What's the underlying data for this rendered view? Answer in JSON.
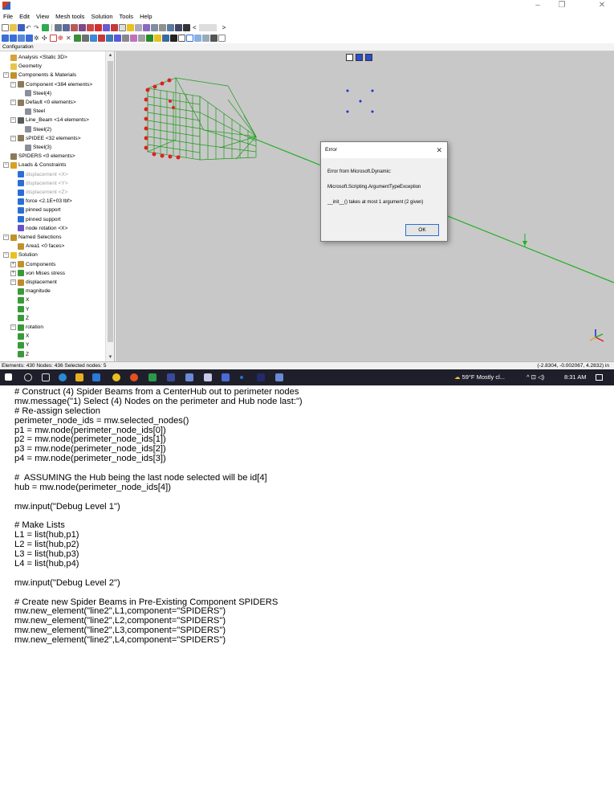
{
  "window": {
    "minimize": "–",
    "restore": "❐",
    "close": "✕"
  },
  "menu": [
    "File",
    "Edit",
    "View",
    "Mesh tools",
    "Solution",
    "Tools",
    "Help"
  ],
  "toolbar": {
    "nav_prev": "<",
    "nav_next": ">"
  },
  "config_label": "Configuration",
  "tree": [
    {
      "label": "Analysis <Static 3D>",
      "indent": 1,
      "icon": "analysis-icon",
      "color": "#d9a13a",
      "grey": false,
      "exp": ""
    },
    {
      "label": "Geometry",
      "indent": 1,
      "icon": "folder-icon",
      "color": "#e8c44a",
      "grey": false,
      "exp": ""
    },
    {
      "label": "Components & Materials",
      "indent": 0,
      "icon": "components-icon",
      "color": "#c0922a",
      "grey": false,
      "exp": "-"
    },
    {
      "label": "Component <384 elements>",
      "indent": 1,
      "icon": "component-icon",
      "color": "#8a7a5a",
      "grey": false,
      "exp": "-"
    },
    {
      "label": "Steel(4)",
      "indent": 3,
      "icon": "material-icon",
      "color": "#8a8f9a",
      "grey": false,
      "exp": ""
    },
    {
      "label": "Default <0 elements>",
      "indent": 1,
      "icon": "component-icon",
      "color": "#8a7a5a",
      "grey": false,
      "exp": "-"
    },
    {
      "label": "Steel",
      "indent": 3,
      "icon": "material-icon",
      "color": "#8a8f9a",
      "grey": false,
      "exp": ""
    },
    {
      "label": "Line_Beam <14 elements>",
      "indent": 1,
      "icon": "beam-icon",
      "color": "#5a5a5a",
      "grey": false,
      "exp": "-"
    },
    {
      "label": "Steel(2)",
      "indent": 3,
      "icon": "material-icon",
      "color": "#8a8f9a",
      "grey": false,
      "exp": ""
    },
    {
      "label": "sPIDEE <32 elements>",
      "indent": 1,
      "icon": "component-icon",
      "color": "#8a7a5a",
      "grey": false,
      "exp": "-"
    },
    {
      "label": "Steel(3)",
      "indent": 3,
      "icon": "material-icon",
      "color": "#8a8f9a",
      "grey": false,
      "exp": ""
    },
    {
      "label": "SPIDERS <0 elements>",
      "indent": 1,
      "icon": "component-icon",
      "color": "#8a7a5a",
      "grey": false,
      "exp": ""
    },
    {
      "label": "Loads & Constraints",
      "indent": 0,
      "icon": "loads-icon",
      "color": "#d8a020",
      "grey": false,
      "exp": "-"
    },
    {
      "label": "displacement <X>",
      "indent": 2,
      "icon": "constraint-icon",
      "color": "#2a6fd6",
      "grey": true,
      "exp": ""
    },
    {
      "label": "displacement <Y>",
      "indent": 2,
      "icon": "constraint-icon",
      "color": "#2a6fd6",
      "grey": true,
      "exp": ""
    },
    {
      "label": "displacement <Z>",
      "indent": 2,
      "icon": "constraint-icon",
      "color": "#2a6fd6",
      "grey": true,
      "exp": ""
    },
    {
      "label": "force <2.1E+03 lbf>",
      "indent": 2,
      "icon": "force-icon",
      "color": "#2a6fd6",
      "grey": false,
      "exp": ""
    },
    {
      "label": "pinned support",
      "indent": 2,
      "icon": "support-icon",
      "color": "#2a6fd6",
      "grey": false,
      "exp": ""
    },
    {
      "label": "pinned support",
      "indent": 2,
      "icon": "support-icon",
      "color": "#2a6fd6",
      "grey": false,
      "exp": ""
    },
    {
      "label": "node rotation <X>",
      "indent": 2,
      "icon": "rotation-icon",
      "color": "#6a4fcf",
      "grey": false,
      "exp": ""
    },
    {
      "label": "Named Selections",
      "indent": 0,
      "icon": "selections-icon",
      "color": "#c0922a",
      "grey": false,
      "exp": "-"
    },
    {
      "label": "Area1 <0 faces>",
      "indent": 2,
      "icon": "area-icon",
      "color": "#c0922a",
      "grey": false,
      "exp": ""
    },
    {
      "label": "Solution",
      "indent": 0,
      "icon": "solution-icon",
      "color": "#e8c020",
      "grey": false,
      "exp": "-"
    },
    {
      "label": "Components",
      "indent": 1,
      "icon": "components-icon",
      "color": "#c0922a",
      "grey": false,
      "exp": "+"
    },
    {
      "label": "von Mises stress",
      "indent": 1,
      "icon": "result-icon",
      "color": "#3a9a3a",
      "grey": false,
      "exp": "+"
    },
    {
      "label": "displacement",
      "indent": 1,
      "icon": "displacement-icon",
      "color": "#c08a2a",
      "grey": false,
      "exp": "-"
    },
    {
      "label": "magnitude",
      "indent": 2,
      "icon": "result-icon",
      "color": "#3a9a3a",
      "grey": false,
      "exp": ""
    },
    {
      "label": "X",
      "indent": 2,
      "icon": "result-icon",
      "color": "#3a9a3a",
      "grey": false,
      "exp": ""
    },
    {
      "label": "Y",
      "indent": 2,
      "icon": "result-icon",
      "color": "#3a9a3a",
      "grey": false,
      "exp": ""
    },
    {
      "label": "Z",
      "indent": 2,
      "icon": "result-icon",
      "color": "#3a9a3a",
      "grey": false,
      "exp": ""
    },
    {
      "label": "rotation",
      "indent": 1,
      "icon": "result-icon",
      "color": "#3a9a3a",
      "grey": false,
      "exp": "-"
    },
    {
      "label": "X",
      "indent": 2,
      "icon": "result-icon",
      "color": "#3a9a3a",
      "grey": false,
      "exp": ""
    },
    {
      "label": "Y",
      "indent": 2,
      "icon": "result-icon",
      "color": "#3a9a3a",
      "grey": false,
      "exp": ""
    },
    {
      "label": "Z",
      "indent": 2,
      "icon": "result-icon",
      "color": "#3a9a3a",
      "grey": false,
      "exp": ""
    }
  ],
  "dialog": {
    "title": "Error",
    "close": "✕",
    "line1": "Error from Microsoft.Dynamic:",
    "line2": "Microsoft.Scripting.ArgumentTypeException",
    "line3": "__init__() takes at most 1 argument (2 given)",
    "ok": "OK"
  },
  "statusbar": {
    "left": "Elements: 430    Nodes: 436    Selected nodes: 5",
    "coords": "(-2.8304, -0.002067, 4.2832) in"
  },
  "taskbar": {
    "weather": "59°F  Mostly cl...",
    "tray": "^  ⊡  ◁)",
    "time": "8:31 AM"
  },
  "code": [
    "# Construct (4) Spider Beams from a CenterHub out to perimeter nodes",
    "mw.message(\"1) Select (4) Nodes on the perimeter and Hub node last:\")",
    "# Re-assign selection",
    "perimeter_node_ids = mw.selected_nodes()",
    "p1 = mw.node(perimeter_node_ids[0])",
    "p2 = mw.node(perimeter_node_ids[1])",
    "p3 = mw.node(perimeter_node_ids[2])",
    "p4 = mw.node(perimeter_node_ids[3])",
    "",
    "#  ASSUMING the Hub being the last node selected will be id[4]",
    "hub = mw.node(perimeter_node_ids[4])",
    "",
    "mw.input(\"Debug Level 1\")",
    "",
    "# Make Lists",
    "L1 = list(hub,p1)",
    "L2 = list(hub,p2)",
    "L3 = list(hub,p3)",
    "L4 = list(hub,p4)",
    "",
    "mw.input(\"Debug Level 2\")",
    "",
    "# Create new Spider Beams in Pre-Existing Component SPIDERS",
    "mw.new_element(\"line2\",L1,component=\"SPIDERS\")",
    "mw.new_element(\"line2\",L2,component=\"SPIDERS\")",
    "mw.new_element(\"line2\",L3,component=\"SPIDERS\")",
    "mw.new_element(\"line2\",L4,component=\"SPIDERS\")"
  ]
}
